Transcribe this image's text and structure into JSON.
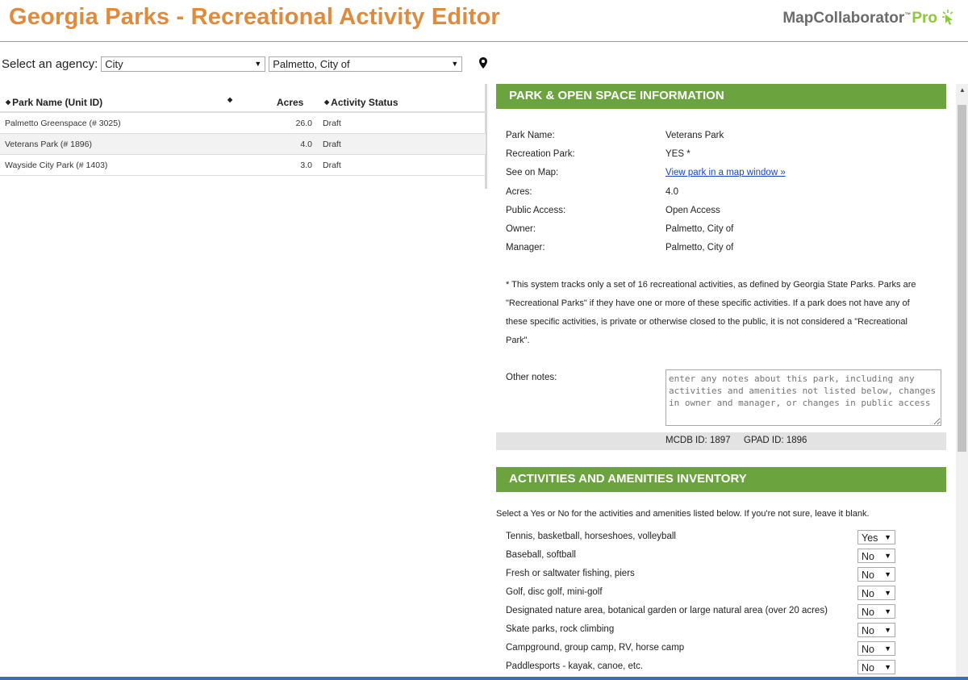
{
  "header": {
    "title": "Georgia Parks - Recreational Activity Editor",
    "brand_name": "MapCollaborator",
    "brand_tm": "™",
    "brand_pro": "Pro"
  },
  "agency_bar": {
    "label": "Select an agency:",
    "type_value": "City",
    "agency_value": "Palmetto, City of",
    "arrow": "▼"
  },
  "park_table": {
    "columns": [
      "Park Name (Unit ID)",
      "",
      "Acres",
      "Activity Status"
    ],
    "rows": [
      {
        "name": "Palmetto Greenspace (# 3025)",
        "acres": "26.0",
        "status": "Draft"
      },
      {
        "name": "Veterans Park (# 1896)",
        "acres": "4.0",
        "status": "Draft"
      },
      {
        "name": "Wayside City Park (# 1403)",
        "acres": "3.0",
        "status": "Draft"
      }
    ]
  },
  "park_info": {
    "heading": "PARK & OPEN SPACE INFORMATION",
    "fields": [
      {
        "label": "Park Name:",
        "value": "Veterans Park"
      },
      {
        "label": "Recreation Park:",
        "value": "YES *"
      },
      {
        "label": "See on Map:",
        "value": "View park in a map window »"
      },
      {
        "label": "Acres:",
        "value": "4.0"
      },
      {
        "label": "Public Access:",
        "value": "Open Access"
      },
      {
        "label": "Owner:",
        "value": "Palmetto, City of"
      },
      {
        "label": "Manager:",
        "value": "Palmetto, City of"
      }
    ],
    "footnote": "* This system tracks only a set of 16 recreational activities, as defined by Georgia State Parks. Parks are \"Recreational Parks\" if they have one or more of these specific activities. If a park does not have any of these specific activities, is private or otherwise closed to the public, it is not considered a \"Recreational Park\".",
    "notes_label": "Other notes:",
    "notes_placeholder": "enter any notes about this park, including any activities and amenities not listed below, changes in owner and manager, or changes in public access",
    "mcdb_id": "MCDB ID: 1897",
    "gpad_id": "GPAD ID: 1896"
  },
  "inventory": {
    "heading": "ACTIVITIES AND AMENITIES INVENTORY",
    "intro": "Select a Yes or No for the activities and amenities listed below. If you're not sure, leave it blank.",
    "items": [
      {
        "label": "Tennis, basketball, horseshoes, volleyball",
        "value": "Yes"
      },
      {
        "label": "Baseball, softball",
        "value": "No"
      },
      {
        "label": "Fresh or saltwater fishing, piers",
        "value": "No"
      },
      {
        "label": "Golf, disc golf, mini-golf",
        "value": "No"
      },
      {
        "label": "Designated nature area, botanical garden or large natural area (over 20 acres)",
        "value": "No"
      },
      {
        "label": "Skate parks, rock climbing",
        "value": "No"
      },
      {
        "label": "Campground, group camp, RV, horse camp",
        "value": "No"
      },
      {
        "label": "Paddlesports - kayak, canoe, etc.",
        "value": "No"
      }
    ]
  },
  "colors": {
    "title_orange": "#e08a3c",
    "section_green": "#6ba33f",
    "brand_green": "#8dc63f",
    "link_blue": "#1a44cc"
  },
  "icons": [
    "cursor-click-icon",
    "map-pin-icon",
    "sort-icon",
    "dropdown-arrow-icon",
    "scroll-up-icon",
    "resize-grip-icon"
  ]
}
